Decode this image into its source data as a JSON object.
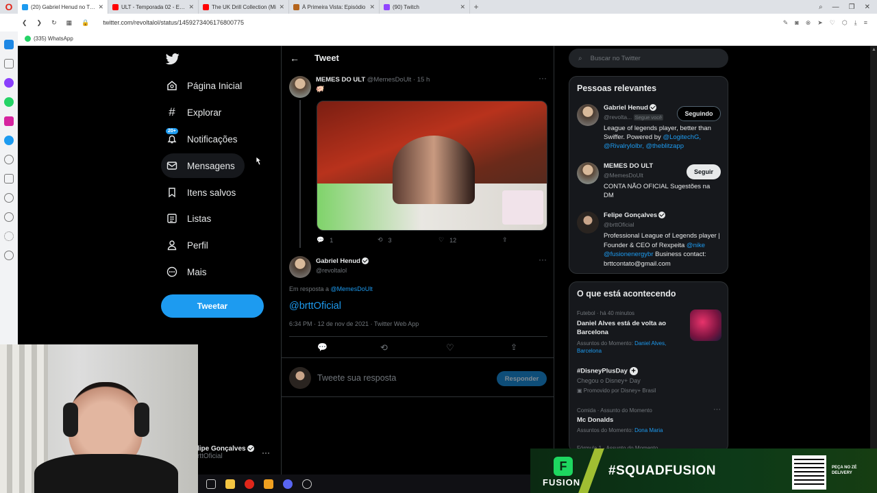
{
  "browser": {
    "tabs": [
      {
        "label": "(20) Gabriel Henud no Twitt",
        "color": "#1d9bf0",
        "active": true
      },
      {
        "label": "ULT - Temporada 02 - Epis",
        "color": "#ff0000",
        "active": false
      },
      {
        "label": "The UK Drill Collection (Mi",
        "color": "#ff0000",
        "active": false
      },
      {
        "label": "À Primeira Vista: Episódio",
        "color": "#b5651d",
        "active": false
      },
      {
        "label": "(90) Twitch",
        "color": "#9146ff",
        "active": false
      }
    ],
    "url": "twitter.com/revoltalol/status/1459273406176800775",
    "bookmark": "(335) WhatsApp"
  },
  "nav": {
    "items": [
      {
        "label": "Página Inicial",
        "icon": "home-icon"
      },
      {
        "label": "Explorar",
        "icon": "hashtag-icon"
      },
      {
        "label": "Notificações",
        "icon": "bell-icon",
        "badge": "20+"
      },
      {
        "label": "Mensagens",
        "icon": "mail-icon"
      },
      {
        "label": "Itens salvos",
        "icon": "bookmark-icon"
      },
      {
        "label": "Listas",
        "icon": "list-icon"
      },
      {
        "label": "Perfil",
        "icon": "person-icon"
      },
      {
        "label": "Mais",
        "icon": "more-circle-icon"
      }
    ],
    "tweet_button": "Tweetar",
    "account_name": "lipe Gonçalves",
    "account_handle": "rttOficial"
  },
  "header": {
    "title": "Tweet"
  },
  "original_tweet": {
    "name": "MEMES DO ULT",
    "handle": "@MemesDoUlt",
    "time": "· 15 h",
    "emoji": "🐖",
    "replies": "1",
    "retweets": "3",
    "likes": "12"
  },
  "main_tweet": {
    "name": "Gabriel Henud",
    "handle": "@revoltalol",
    "reply_prefix": "Em resposta a",
    "reply_to": "@MemesDoUlt",
    "text": "@brttOficial",
    "meta": "6:34 PM · 12 de nov de 2021 · Twitter Web App"
  },
  "reply_box": {
    "placeholder": "Tweete sua resposta",
    "button": "Responder"
  },
  "search": {
    "placeholder": "Buscar no Twitter"
  },
  "relevant": {
    "title": "Pessoas relevantes",
    "people": [
      {
        "name": "Gabriel Henud",
        "handle": "@revolta...",
        "follows_you": "Segue você",
        "button": "Seguindo",
        "bio": "League of legends player, better than Swiffer. Powered by ",
        "links": "@LogitechG, @Rivalrylolbr, @theblitzapp"
      },
      {
        "name": "MEMES DO ULT",
        "handle": "@MemesDoUlt",
        "button": "Seguir",
        "bio": "CONTA NÃO OFICIAL Sugestões na DM"
      },
      {
        "name": "Felipe Gonçalves",
        "handle": "@brttOficial",
        "bio1": "Professional League of Legends player | Founder & CEO of Rexpeita ",
        "link1": "@nike",
        "link2": "@fusionenergybr",
        "bio2": " Business contact: brttcontato@gmail.com"
      }
    ]
  },
  "trends": {
    "title": "O que está acontecendo",
    "items": [
      {
        "meta": "Futebol · há 40 minutos",
        "title": "Daniel Alves está de volta ao Barcelona",
        "sub": "Assuntos do Momento:",
        "links": "Daniel Alves, Barcelona"
      },
      {
        "title": "#DisneyPlusDay",
        "desc": "Chegou o Disney+ Day",
        "promo": "Promovido por Disney+ Brasil"
      },
      {
        "meta": "Comida · Assunto do Momento",
        "title": "Mc Donalds",
        "sub": "Assuntos do Momento:",
        "links": "Dona Maria"
      },
      {
        "meta": "Fórmula 1 · Assunto do Momento"
      }
    ]
  },
  "overlay": {
    "brand": "FUSION",
    "hashtag": "#SQUADFUSION",
    "promo": "PEÇA NO ZÉ DELIVERY"
  },
  "colors": {
    "twitter_blue": "#1d9bf0",
    "bg": "#000000",
    "border": "#2f3336"
  }
}
